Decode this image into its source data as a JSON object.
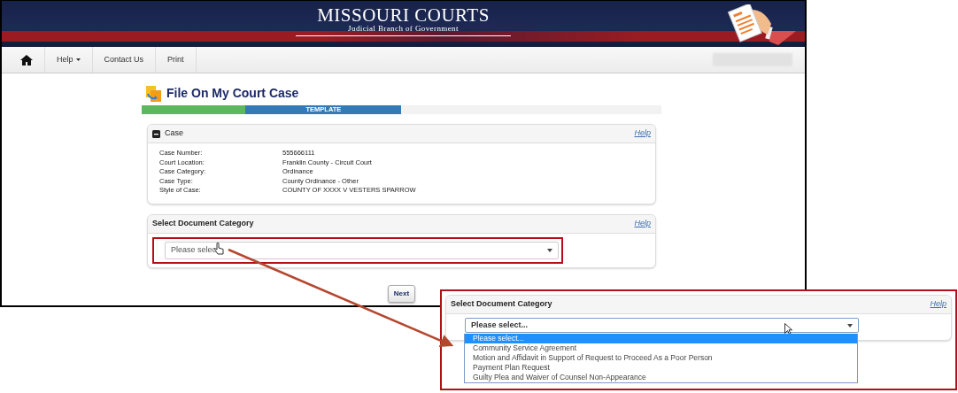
{
  "banner": {
    "logo_title": "MISSOURI COURTS",
    "logo_subtitle": "Judicial Branch of Government"
  },
  "navbar": {
    "items": [
      {
        "kind": "home"
      },
      {
        "kind": "dropdown",
        "label": "Help"
      },
      {
        "kind": "link",
        "label": "Contact Us"
      },
      {
        "kind": "link",
        "label": "Print"
      }
    ]
  },
  "page_title": "File On My Court Case",
  "progress": {
    "segments": [
      {
        "kind": "done",
        "level": 0.2
      },
      {
        "kind": "current",
        "label": "TEMPLATE",
        "level": 0.3
      }
    ]
  },
  "case_panel": {
    "title": "Case",
    "expanded": true,
    "help": "Help",
    "fields": [
      {
        "label": "Case Number:",
        "value": "555666111"
      },
      {
        "label": "Court Location:",
        "value": "Franklin County - Circuit Court"
      },
      {
        "label": "Case Category:",
        "value": "Ordinance"
      },
      {
        "label": "Case Type:",
        "value": "County Ordinance - Other"
      },
      {
        "label": "Style of Case:",
        "value": "COUNTY OF XXXX V VESTERS SPARROW"
      }
    ]
  },
  "category_panel": {
    "title": "Select Document Category",
    "help": "Help",
    "select_value": "Please selec"
  },
  "next_button": "Next",
  "callout": {
    "title": "Select Document Category",
    "help": "Help",
    "select_value": "Please select...",
    "options": [
      {
        "label": "Please select...",
        "selected": true
      },
      {
        "label": "Community Service Agreement",
        "selected": false
      },
      {
        "label": "Motion and Affidavit in Support of Request to Proceed As a Poor Person",
        "selected": false
      },
      {
        "label": "Payment Plan Request",
        "selected": false
      },
      {
        "label": "Guilty Plea and Waiver of Counsel Non-Appearance",
        "selected": false
      }
    ]
  }
}
